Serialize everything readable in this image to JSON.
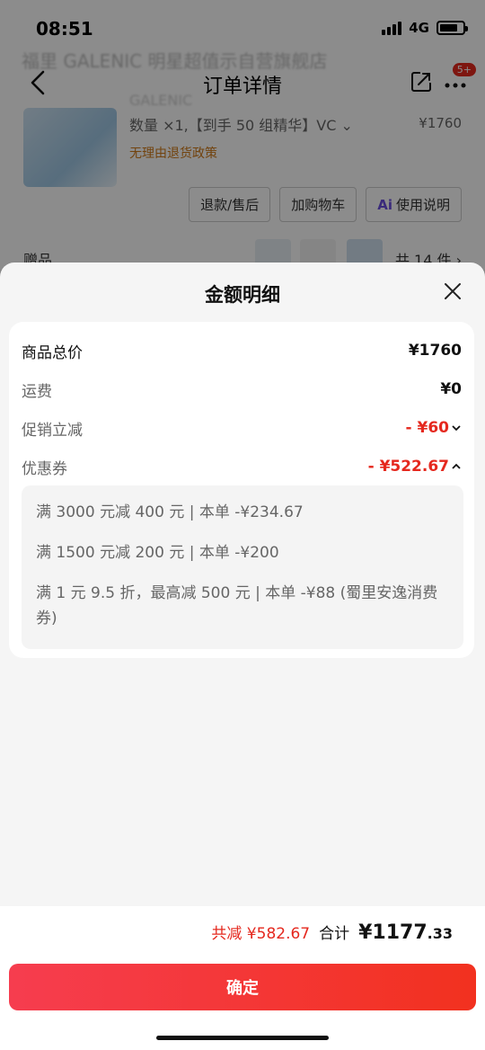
{
  "status_bar": {
    "time": "08:51",
    "network": "4G"
  },
  "background": {
    "marquee_text": "福里 GALENIC 明星超值示自营旗舰店",
    "nav_title": "订单详情",
    "more_badge": "5+",
    "product": {
      "name_blur": "GALENIC",
      "qty_spec": "数量 ×1,【到手 50 组精华】VC ⌄",
      "price": "¥1760",
      "policy": "无理由退货政策"
    },
    "actions": [
      {
        "label": "退款/售后",
        "icon": ""
      },
      {
        "label": "加购物车",
        "icon": ""
      },
      {
        "label": "使用说明",
        "icon": "Ai"
      }
    ],
    "gift_label": "赠品",
    "gift_count": "共 14 件 ›"
  },
  "sheet": {
    "title": "金额明细",
    "rows": [
      {
        "label": "商品总价",
        "value": "¥1760"
      },
      {
        "label": "运费",
        "value": "¥0"
      },
      {
        "label": "促销立减",
        "value": "- ¥60",
        "icon": "chevron-down-icon"
      },
      {
        "label": "优惠券",
        "value": "- ¥522.67",
        "icon": "chevron-up-icon"
      }
    ],
    "coupons": [
      "满 3000 元减 400 元 | 本单 -¥234.67",
      "满 1500 元减 200 元 | 本单 -¥200",
      "满 1 元 9.5 折，最高减 500 元 | 本单 -¥88 (蜀里安逸消费券)"
    ]
  },
  "footer": {
    "total_discount": "共减 ¥582.67",
    "total_label": "合计",
    "total_integer": "¥1177",
    "total_decimal": ".33",
    "confirm_label": "确定"
  },
  "colors": {
    "accent_red": "#e5281e",
    "button_gradient_start": "#f63d4f",
    "button_gradient_end": "#f2311f"
  }
}
